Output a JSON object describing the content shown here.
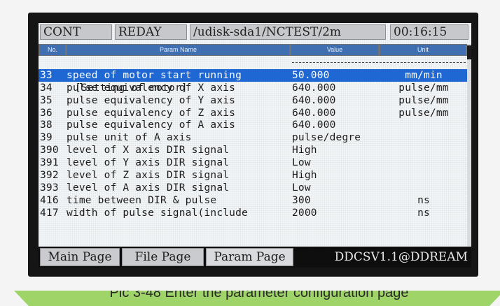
{
  "status_bar": {
    "mode": "CONT",
    "state": "REDAY",
    "path": "/udisk-sda1/NCTEST/2m",
    "time": "00:16:15"
  },
  "table": {
    "headers": {
      "no": "No.",
      "name": "Param Name",
      "value": "Value",
      "unit": "Unit"
    },
    "section": {
      "prefix": "---",
      "title": "[Setting of motor]"
    },
    "selected_index": 0,
    "rows": [
      {
        "no": "33",
        "name": "speed of motor start running",
        "value": "50.000",
        "unit": "mm/min"
      },
      {
        "no": "34",
        "name": "pulse equivalency of X axis",
        "value": "640.000",
        "unit": "pulse/mm"
      },
      {
        "no": "35",
        "name": "pulse equivalency of Y axis",
        "value": "640.000",
        "unit": "pulse/mm"
      },
      {
        "no": "36",
        "name": "pulse equivalency of Z axis",
        "value": "640.000",
        "unit": "pulse/mm"
      },
      {
        "no": "38",
        "name": "pulse equivalency of A axis",
        "value": "640.000",
        "unit": ""
      },
      {
        "no": "39",
        "name": "pulse unit of A axis",
        "value": "pulse/degre",
        "unit": ""
      },
      {
        "no": "390",
        "name": "level of X axis DIR signal",
        "value": "High",
        "unit": ""
      },
      {
        "no": "391",
        "name": "level of Y axis DIR signal",
        "value": "Low",
        "unit": ""
      },
      {
        "no": "392",
        "name": "level of Z axis DIR signal",
        "value": "High",
        "unit": ""
      },
      {
        "no": "393",
        "name": "level of A axis DIR signal",
        "value": "Low",
        "unit": ""
      },
      {
        "no": "416",
        "name": "time between DIR & pulse",
        "value": "300",
        "unit": "ns"
      },
      {
        "no": "417",
        "name": "width of pulse signal(include",
        "value": "2000",
        "unit": "ns"
      }
    ]
  },
  "tabs": {
    "main": "Main Page",
    "file": "File Page",
    "param": "Param Page",
    "active": "param"
  },
  "firmware": "DDCSV1.1@DDREAM",
  "caption": "Pic 3-48 Enter the parameter configuration page",
  "colors": {
    "selection": "#1f67d3",
    "header": "#3f6fb0",
    "caption_band": "#9fd468"
  }
}
